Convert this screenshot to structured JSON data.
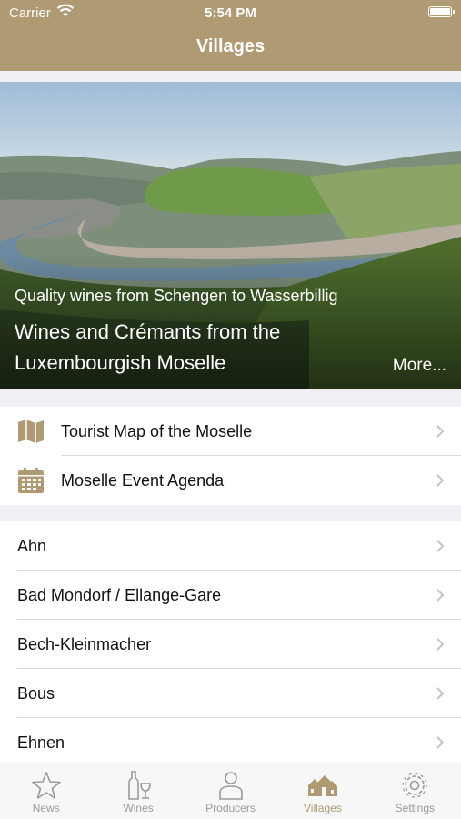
{
  "status_bar": {
    "carrier": "Carrier",
    "time": "5:54 PM"
  },
  "nav": {
    "title": "Villages"
  },
  "hero": {
    "subtitle": "Quality wines from Schengen to Wasserbillig",
    "title": "Wines and Crémants from the Luxembourgish Moselle",
    "more_label": "More..."
  },
  "links": [
    {
      "label": "Tourist Map of the Moselle",
      "icon": "map-icon"
    },
    {
      "label": "Moselle Event Agenda",
      "icon": "calendar-icon"
    }
  ],
  "villages": [
    "Ahn",
    "Bad Mondorf / Ellange-Gare",
    "Bech-Kleinmacher",
    "Bous",
    "Ehnen"
  ],
  "tabs": [
    {
      "label": "News",
      "icon": "star-icon"
    },
    {
      "label": "Wines",
      "icon": "wine-bottle-icon"
    },
    {
      "label": "Producers",
      "icon": "person-icon"
    },
    {
      "label": "Villages",
      "icon": "houses-icon",
      "active": true
    },
    {
      "label": "Settings",
      "icon": "gear-icon"
    }
  ],
  "colors": {
    "accent": "#b09a73",
    "inactive": "#9a9a9a",
    "background": "#efeff4"
  }
}
